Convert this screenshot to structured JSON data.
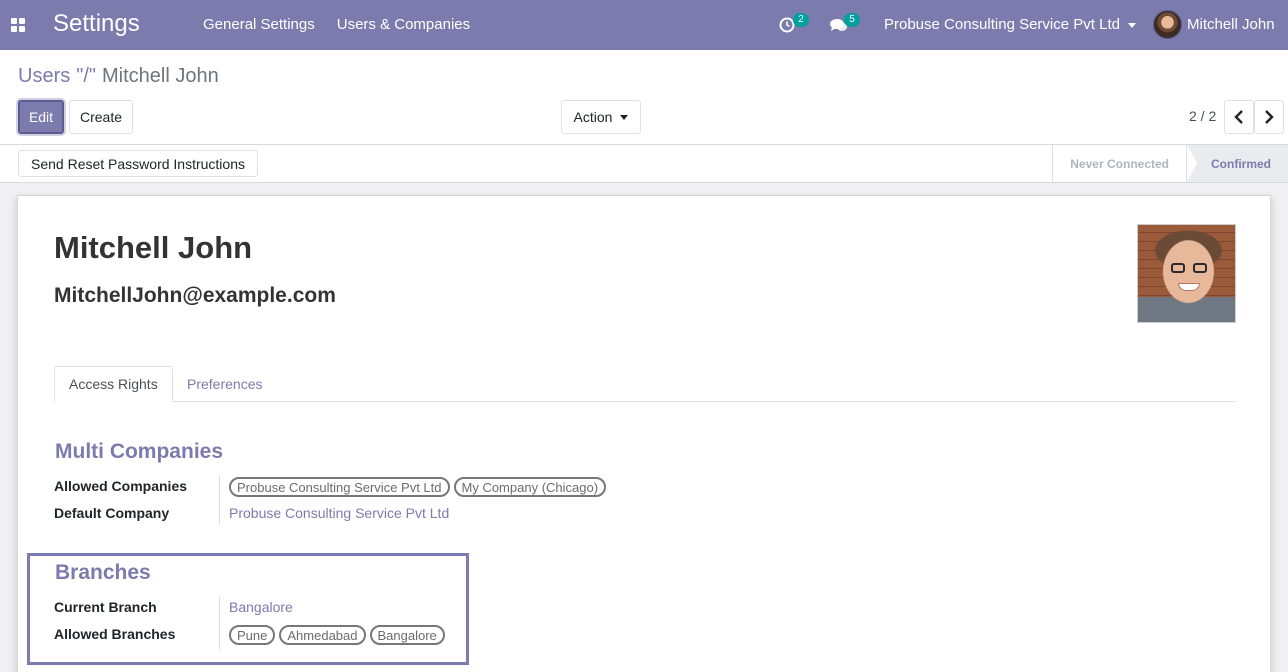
{
  "navbar": {
    "app_title": "Settings",
    "menu": [
      "General Settings",
      "Users & Companies"
    ],
    "activity_count": "2",
    "messages_count": "5",
    "company": "Probuse Consulting Service Pvt Ltd",
    "user": "Mitchell John",
    "color": "#7c7bad"
  },
  "breadcrumb": {
    "parent": "Users",
    "separator": "\"/\"",
    "current": "Mitchell John"
  },
  "buttons": {
    "edit": "Edit",
    "create": "Create",
    "action": "Action",
    "reset_password": "Send Reset Password Instructions"
  },
  "pager": {
    "value": "2 / 2"
  },
  "status": {
    "steps": [
      "Never Connected",
      "Confirmed"
    ],
    "current": "Confirmed"
  },
  "user": {
    "name": "Mitchell John",
    "login": "MitchellJohn@example.com"
  },
  "tabs": [
    "Access Rights",
    "Preferences"
  ],
  "multi_companies": {
    "title": "Multi Companies",
    "allowed_label": "Allowed Companies",
    "allowed": [
      "Probuse Consulting Service Pvt Ltd",
      "My Company (Chicago)"
    ],
    "default_label": "Default Company",
    "default": "Probuse Consulting Service Pvt Ltd"
  },
  "branches": {
    "title": "Branches",
    "current_label": "Current Branch",
    "current": "Bangalore",
    "allowed_label": "Allowed Branches",
    "allowed": [
      "Pune",
      "Ahmedabad",
      "Bangalore"
    ]
  }
}
